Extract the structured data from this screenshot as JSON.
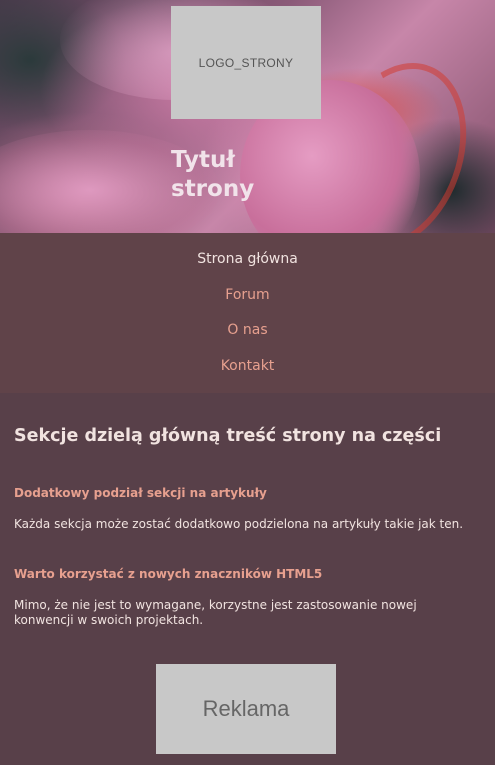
{
  "header": {
    "logo_text": "LOGO_STRONY",
    "title_line1": "Tytuł",
    "title_line2": "strony"
  },
  "nav": {
    "items": [
      {
        "label": "Strona główna",
        "active": true
      },
      {
        "label": "Forum",
        "active": false
      },
      {
        "label": "O nas",
        "active": false
      },
      {
        "label": "Kontakt",
        "active": false
      }
    ]
  },
  "main": {
    "section_heading": "Sekcje dzielą główną treść strony na części",
    "articles": [
      {
        "heading": "Dodatkowy podział sekcji na artykuły",
        "text": "Każda sekcja może zostać dodatkowo podzielona na artykuły takie jak ten."
      },
      {
        "heading": "Warto korzystać z nowych znaczników HTML5",
        "text": "Mimo, że nie jest to wymagane, korzystne jest zastosowanie nowej konwencji w swoich projektach."
      }
    ],
    "ad_text": "Reklama"
  },
  "colors": {
    "nav_bg": "#604349",
    "main_bg": "#584049",
    "link_accent": "#e7a08f",
    "text_light": "#f1e3e0",
    "placeholder_gray": "#c8c8c8"
  }
}
